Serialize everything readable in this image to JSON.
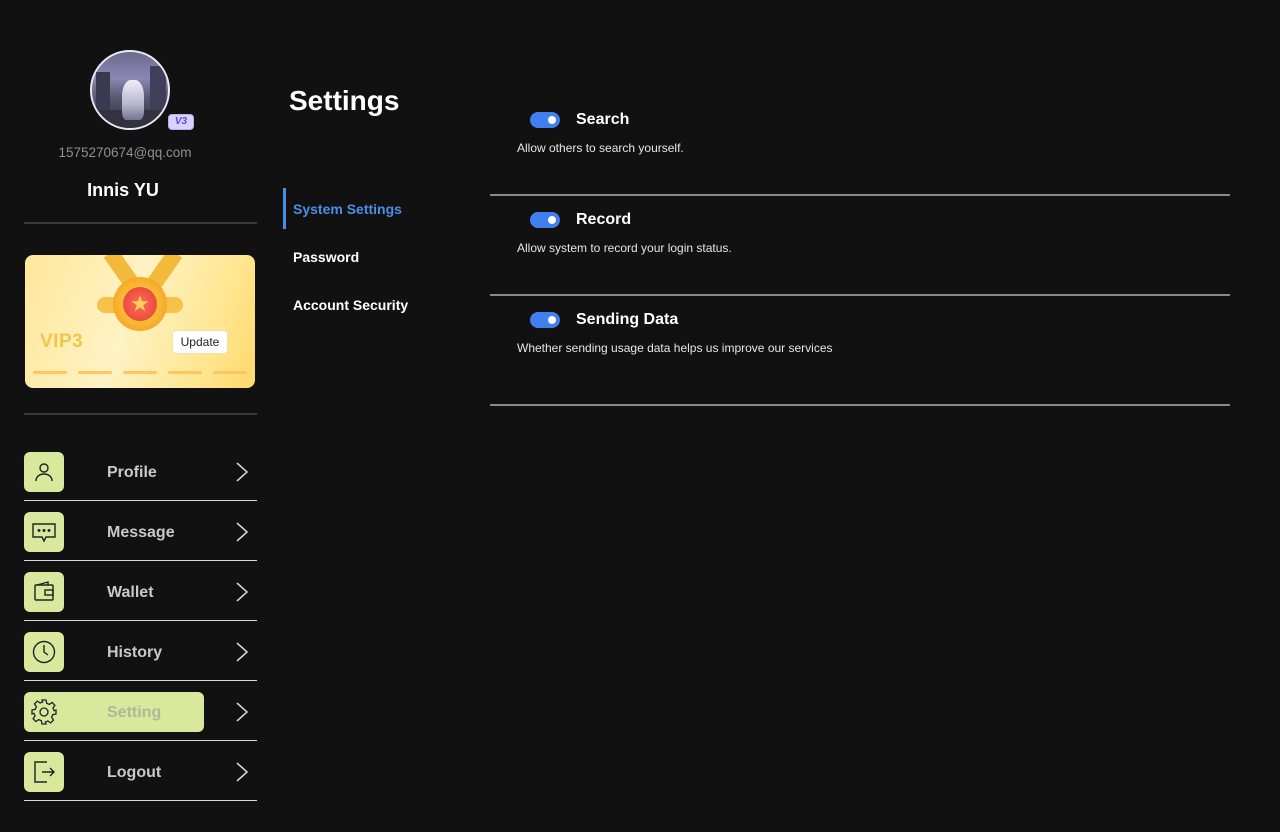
{
  "profile": {
    "email": "1575270674@qq.com",
    "name": "Innis YU",
    "level_badge": "V3"
  },
  "vip_card": {
    "label": "VIP3",
    "update_label": "Update"
  },
  "menu": [
    {
      "label": "Profile",
      "icon": "user-icon"
    },
    {
      "label": "Message",
      "icon": "chat-icon"
    },
    {
      "label": "Wallet",
      "icon": "wallet-icon"
    },
    {
      "label": "History",
      "icon": "clock-icon"
    },
    {
      "label": "Setting",
      "icon": "gear-icon",
      "active": true
    },
    {
      "label": "Logout",
      "icon": "logout-icon"
    }
  ],
  "page": {
    "title": "Settings"
  },
  "subnav": [
    {
      "label": "System Settings",
      "active": true
    },
    {
      "label": "Password"
    },
    {
      "label": "Account Security"
    }
  ],
  "settings": [
    {
      "title": "Search",
      "description": "Allow others to search yourself.",
      "enabled": true
    },
    {
      "title": "Record",
      "description": "Allow system to record your login status.",
      "enabled": true
    },
    {
      "title": "Sending Data",
      "description": "Whether sending usage data helps us improve our services",
      "enabled": true
    }
  ],
  "colors": {
    "background": "#111111",
    "accent_blue": "#3f7ff0",
    "menu_icon_bg": "#d8e89c",
    "active_subnav": "#4a8ee6"
  }
}
